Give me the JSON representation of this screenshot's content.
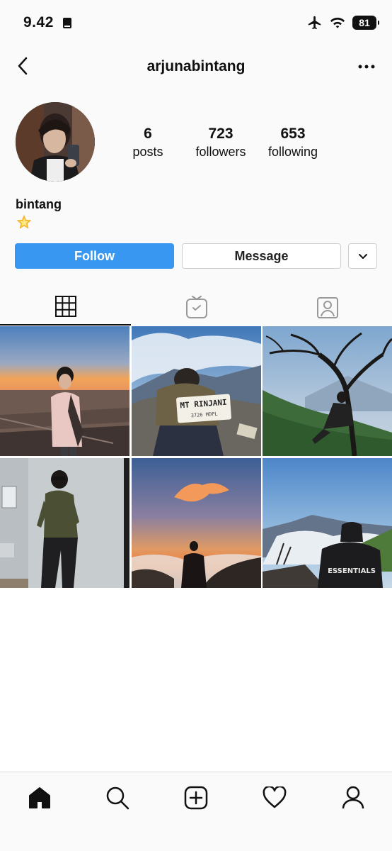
{
  "status_bar": {
    "time": "9.42",
    "battery": "81",
    "icons": [
      "book-icon",
      "airplane-icon",
      "wifi-icon",
      "battery-icon"
    ]
  },
  "header": {
    "username": "arjunabintang",
    "back_icon": "chevron-left-icon",
    "more_icon": "more-horizontal-icon"
  },
  "profile": {
    "stats": [
      {
        "value": "6",
        "label": "posts"
      },
      {
        "value": "723",
        "label": "followers"
      },
      {
        "value": "653",
        "label": "following"
      }
    ],
    "name": "bintang",
    "bio_emoji": "star-emoji"
  },
  "actions": {
    "follow": "Follow",
    "message": "Message",
    "dropdown_icon": "chevron-down-icon"
  },
  "tabs": [
    {
      "name": "posts-grid",
      "icon": "grid-icon",
      "active": true
    },
    {
      "name": "igtv",
      "icon": "tv-icon",
      "active": false
    },
    {
      "name": "tagged",
      "icon": "tagged-person-icon",
      "active": false
    }
  ],
  "posts": {
    "sign_text": "MT RINJANI",
    "sign_sub": "3726 MDPL",
    "hoodie_text": "ESSENTIALS"
  },
  "bottom_nav": [
    {
      "name": "home",
      "icon": "home-icon",
      "active": true
    },
    {
      "name": "search",
      "icon": "search-icon",
      "active": false
    },
    {
      "name": "create",
      "icon": "plus-square-icon",
      "active": false
    },
    {
      "name": "activity",
      "icon": "heart-icon",
      "active": false
    },
    {
      "name": "profile",
      "icon": "person-icon",
      "active": false
    }
  ],
  "colors": {
    "accent": "#3897f0",
    "background": "#fafafa",
    "text": "#111111"
  }
}
